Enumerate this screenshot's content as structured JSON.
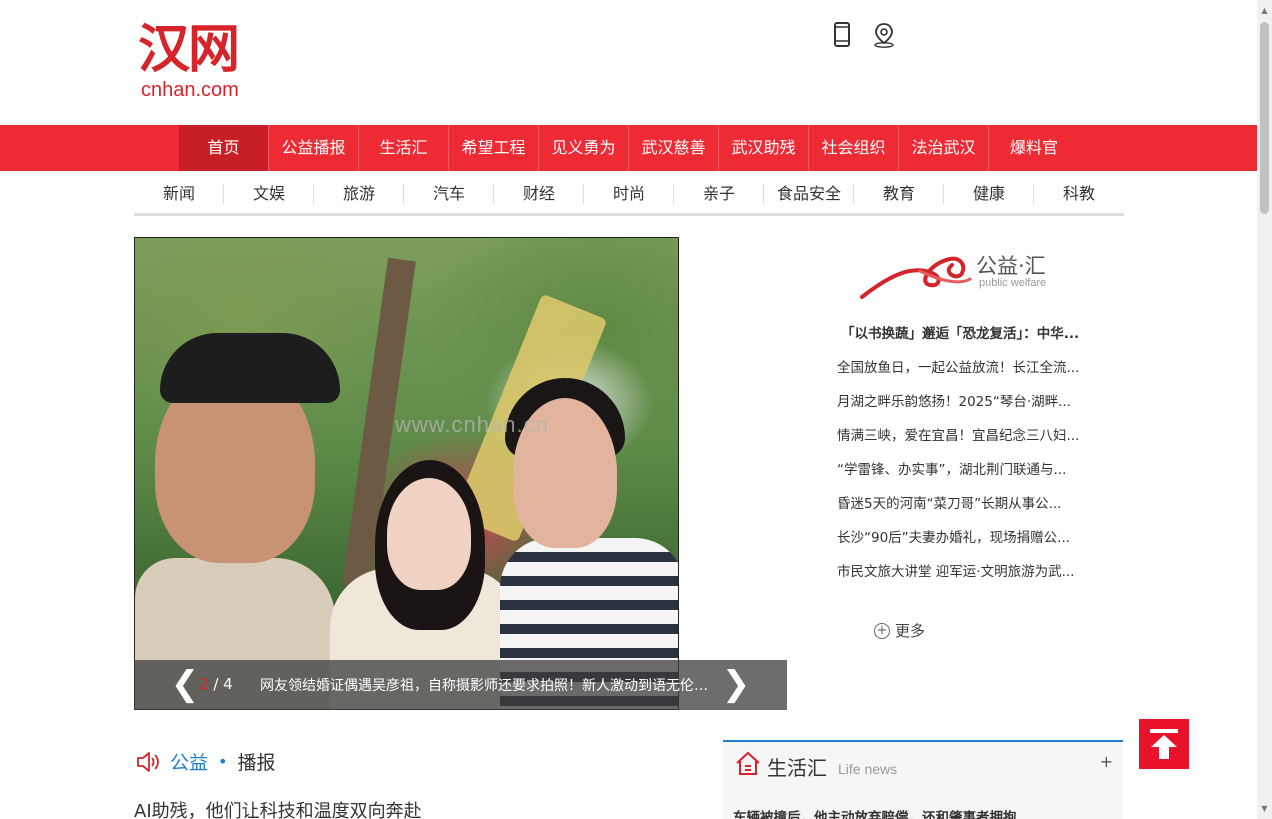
{
  "header": {
    "logo_cn": "汉网",
    "logo_en": "cnhan.com"
  },
  "nav": {
    "items": [
      {
        "label": "首页"
      },
      {
        "label": "公益播报"
      },
      {
        "label": "生活汇"
      },
      {
        "label": "希望工程"
      },
      {
        "label": "见义勇为"
      },
      {
        "label": "武汉慈善"
      },
      {
        "label": "武汉助残"
      },
      {
        "label": "社会组织"
      },
      {
        "label": "法治武汉"
      },
      {
        "label": "爆料官"
      }
    ],
    "active_index": 0,
    "color": "#ee2a34",
    "active_color": "#c81e26"
  },
  "subnav": {
    "items": [
      {
        "label": "新闻"
      },
      {
        "label": "文娱"
      },
      {
        "label": "旅游"
      },
      {
        "label": "汽车"
      },
      {
        "label": "财经"
      },
      {
        "label": "时尚"
      },
      {
        "label": "亲子"
      },
      {
        "label": "食品安全"
      },
      {
        "label": "教育"
      },
      {
        "label": "健康"
      },
      {
        "label": "科教"
      }
    ]
  },
  "slider": {
    "current": "2",
    "total": "/ 4",
    "caption": "网友领结婚证偶遇吴彦祖，自称摄影师还要求拍照！新人激动到语无伦次...",
    "watermark": "www.cnhan.cn"
  },
  "welfare": {
    "title": "公益·汇",
    "subtitle": "public welfare",
    "items": [
      {
        "text": "「以书换蔬」邂逅「恐龙复活」：中华..."
      },
      {
        "text": "全国放鱼日，一起公益放流！长江全流..."
      },
      {
        "text": "月湖之畔乐韵悠扬！2025“琴台·湖畔..."
      },
      {
        "text": "情满三峡，爱在宜昌！宜昌纪念三八妇..."
      },
      {
        "text": "“学雷锋、办实事”，湖北荆门联通与..."
      },
      {
        "text": "昏迷5天的河南“菜刀哥”长期从事公..."
      },
      {
        "text": "长沙“90后”夫妻办婚礼，现场捐赠公..."
      },
      {
        "text": "市民文旅大讲堂 迎军运·文明旅游为武..."
      }
    ],
    "more_label": "更多"
  },
  "broadcast": {
    "title_a": "公益",
    "dot": "•",
    "title_b": "播报",
    "first_news": "AI助残，他们让科技和温度双向奔赴"
  },
  "life": {
    "title": "生活汇",
    "subtitle": "Life news",
    "plus": "+",
    "first_news": "车辆被撞后，他主动放弃赔偿，还和肇事者拥抱......"
  }
}
